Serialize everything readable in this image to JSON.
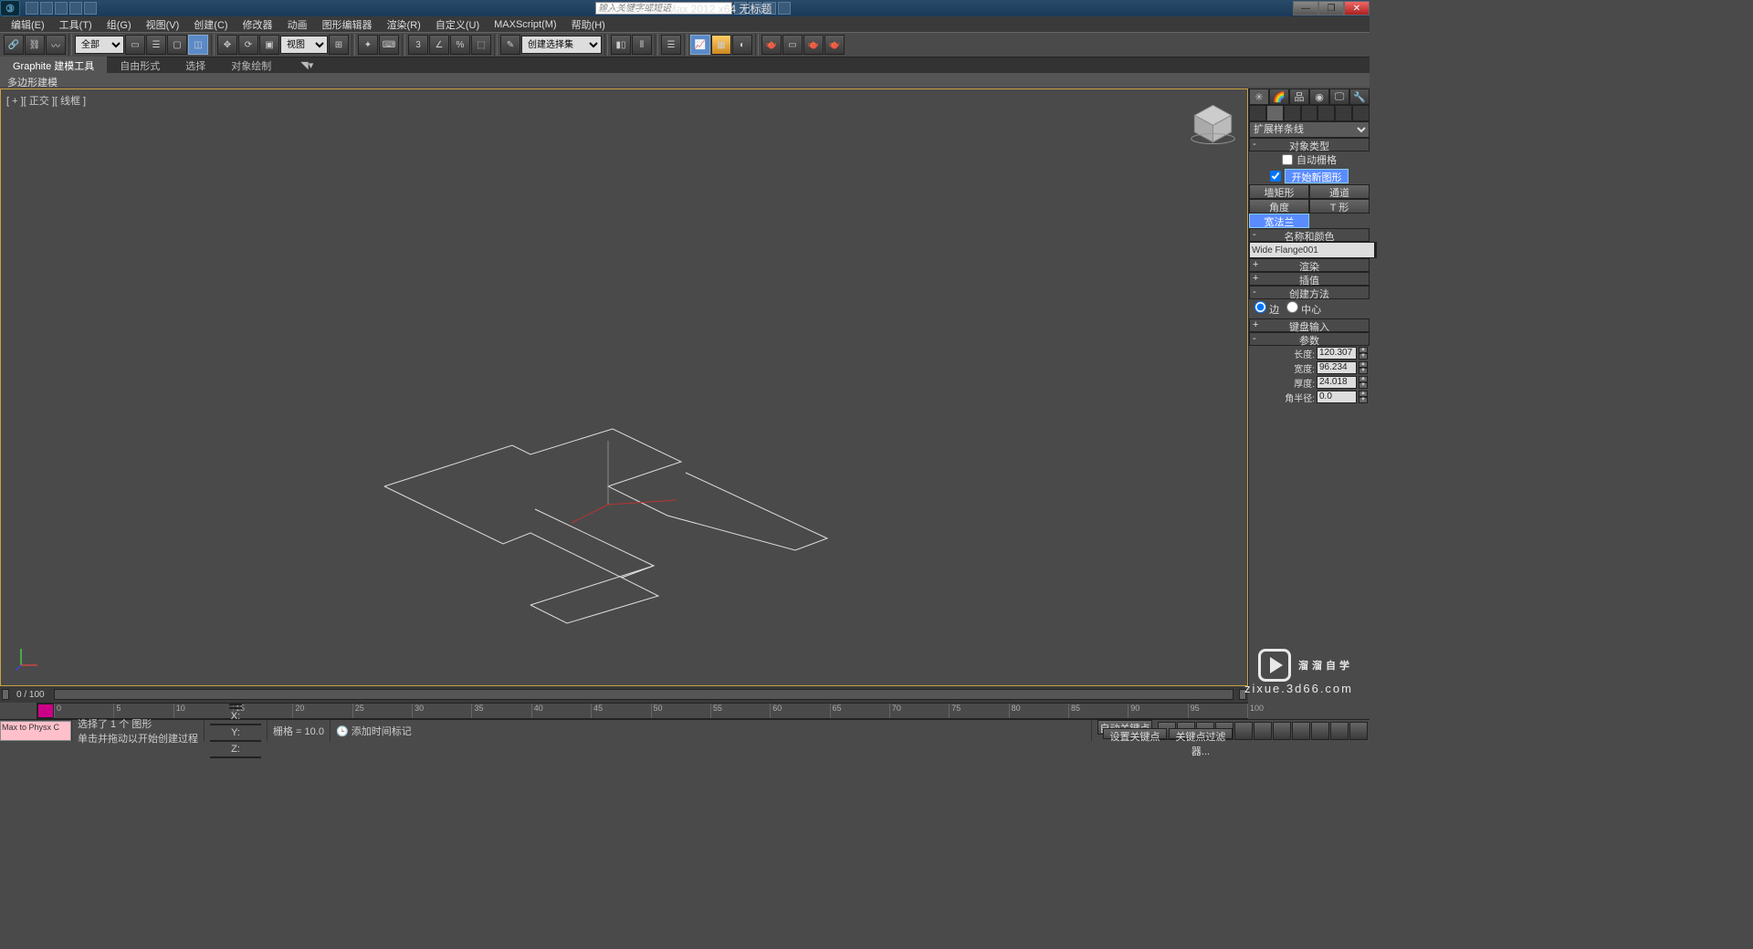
{
  "title_bar": {
    "app_title": "Autodesk 3ds Max  2012 x64     无标题",
    "search_placeholder": "输入关键字或短语"
  },
  "menu": [
    "编辑(E)",
    "工具(T)",
    "组(G)",
    "视图(V)",
    "创建(C)",
    "修改器",
    "动画",
    "图形编辑器",
    "渲染(R)",
    "自定义(U)",
    "MAXScript(M)",
    "帮助(H)"
  ],
  "toolbar": {
    "filter_all": "全部",
    "view_label": "视图",
    "named_sel": "创建选择集"
  },
  "ribbon": {
    "tabs": [
      "Graphite 建模工具",
      "自由形式",
      "选择",
      "对象绘制"
    ],
    "sub": "多边形建模"
  },
  "viewport": {
    "label": "[ + ][ 正交 ][ 线框 ]"
  },
  "panel": {
    "dropdown": "扩展样条线",
    "rollouts": {
      "object_type": "对象类型",
      "auto_grid": "自动栅格",
      "start_new": "开始新图形",
      "name_color": "名称和颜色",
      "render": "渲染",
      "interp": "插值",
      "method": "创建方法",
      "kb": "键盘输入",
      "params": "参数"
    },
    "types": {
      "wrect": "墙矩形",
      "channel": "通道",
      "angle": "角度",
      "tee": "T 形",
      "wf": "宽法兰"
    },
    "name_value": "Wide Flange001",
    "method_opts": {
      "edge": "边",
      "center": "中心"
    },
    "params": {
      "length": {
        "label": "长度:",
        "value": "120.307"
      },
      "width": {
        "label": "宽度:",
        "value": "96.234"
      },
      "thick": {
        "label": "厚度:",
        "value": "24.018"
      },
      "cradius": {
        "label": "角半径:",
        "value": "0.0"
      }
    }
  },
  "track": {
    "pos": "0 / 100"
  },
  "timeline_ticks": [
    "0",
    "5",
    "10",
    "15",
    "20",
    "25",
    "30",
    "35",
    "40",
    "45",
    "50",
    "55",
    "60",
    "65",
    "70",
    "75",
    "80",
    "85",
    "90",
    "95",
    "100"
  ],
  "status": {
    "script": "Max to Physx C",
    "sel": "选择了 1 个 图形",
    "hint": "单击并拖动以开始创建过程",
    "x": "X:",
    "y": "Y:",
    "z": "Z:",
    "grid": "栅格 = 10.0",
    "add_marker": "添加时间标记",
    "autokey": "自动关键点",
    "setkey": "设置关键点",
    "keyfilter": "关键点过滤器..."
  },
  "watermark": {
    "brand": "溜溜自学",
    "url": "zixue.3d66.com"
  }
}
